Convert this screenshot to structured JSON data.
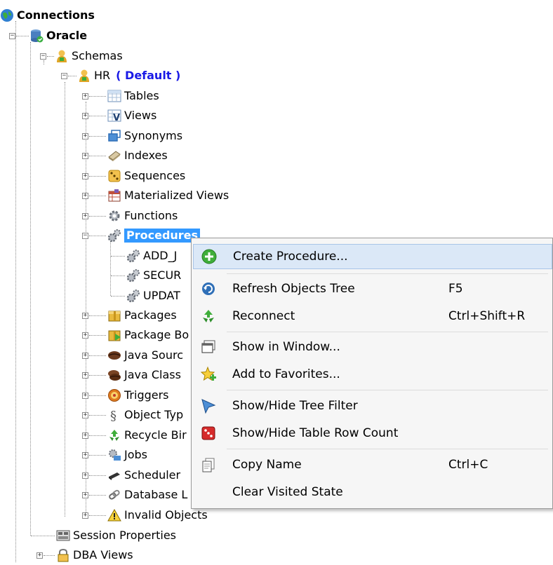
{
  "tree": {
    "connections": "Connections",
    "oracle": "Oracle",
    "schemas": "Schemas",
    "hr": "HR",
    "hr_default": "( Default )",
    "tables": "Tables",
    "views": "Views",
    "synonyms": "Synonyms",
    "indexes": "Indexes",
    "sequences": "Sequences",
    "materialized_views": "Materialized Views",
    "functions": "Functions",
    "procedures": "Procedures",
    "proc_items": [
      "ADD_J",
      "SECUR",
      "UPDAT"
    ],
    "packages": "Packages",
    "package_bodies": "Package Bo",
    "java_sources": "Java Sourc",
    "java_classes": "Java Class",
    "triggers": "Triggers",
    "object_types": "Object Typ",
    "recycle_bin": "Recycle Bir",
    "jobs": "Jobs",
    "scheduler": "Scheduler",
    "database_links": "Database L",
    "invalid_objects": "Invalid Objects",
    "session_properties": "Session Properties",
    "dba_views": "DBA Views"
  },
  "menu": {
    "create_procedure": "Create Procedure...",
    "refresh_objects_tree": "Refresh Objects Tree",
    "refresh_key": "F5",
    "reconnect": "Reconnect",
    "reconnect_key": "Ctrl+Shift+R",
    "show_in_window": "Show in Window...",
    "add_to_favorites": "Add to Favorites...",
    "show_hide_tree_filter": "Show/Hide Tree Filter",
    "show_hide_row_count": "Show/Hide Table Row Count",
    "copy_name": "Copy Name",
    "copy_name_key": "Ctrl+C",
    "clear_visited_state": "Clear Visited State"
  },
  "colors": {
    "selection": "#3399ff",
    "default_tag": "#1a1ae6",
    "menu_hover": "#dbe8f7"
  }
}
